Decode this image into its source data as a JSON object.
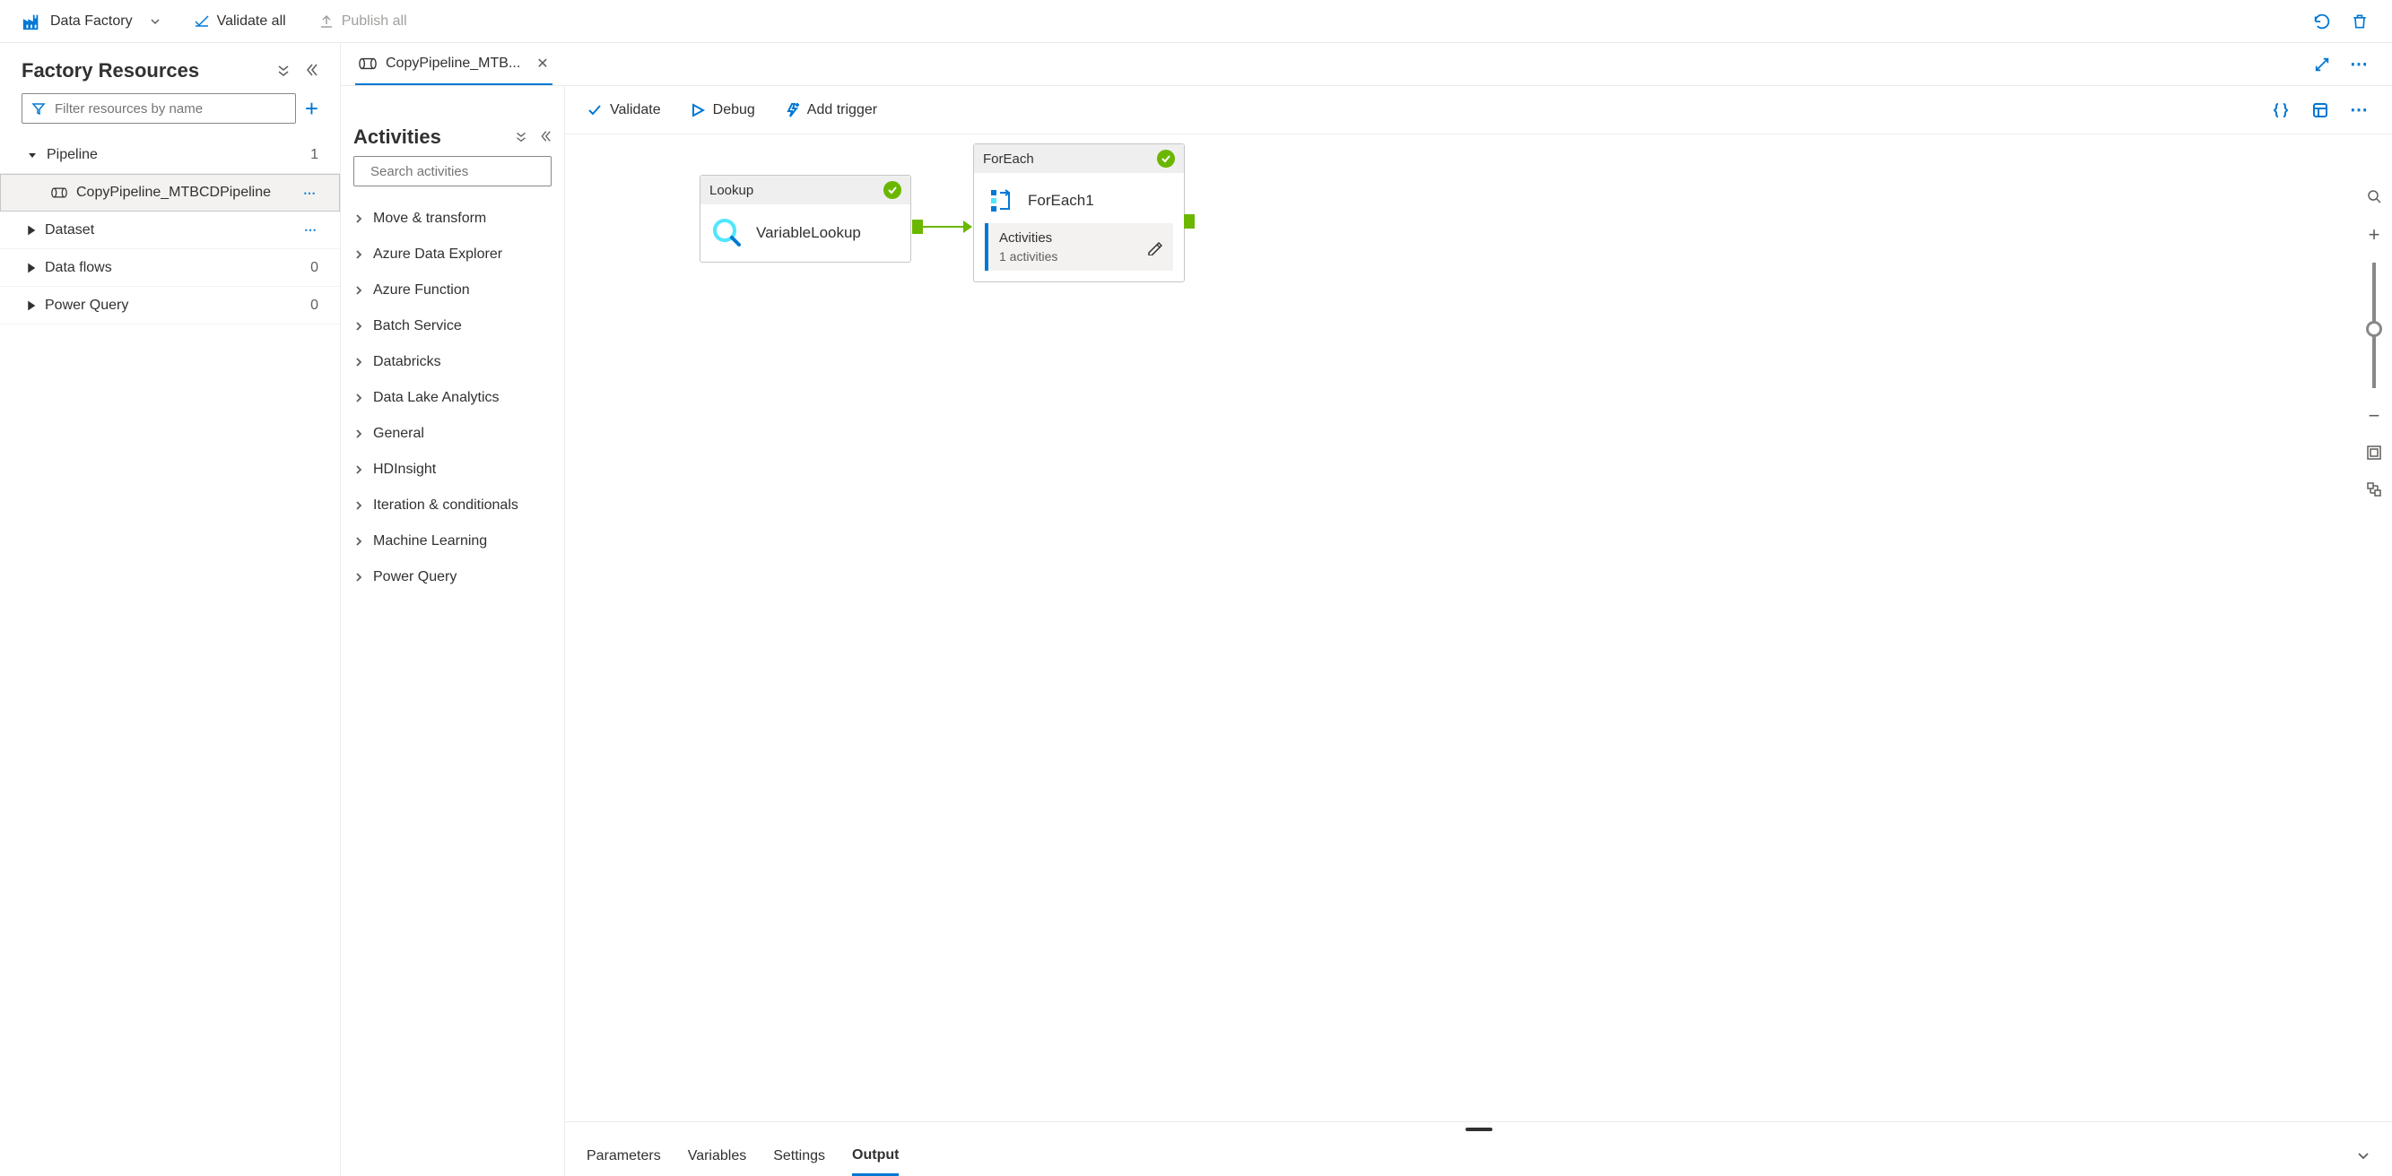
{
  "toolbar": {
    "brand": "Data Factory",
    "validate_all": "Validate all",
    "publish_all": "Publish all"
  },
  "left": {
    "title": "Factory Resources",
    "filter_placeholder": "Filter resources by name",
    "groups": [
      {
        "label": "Pipeline",
        "count": "1",
        "expanded": true
      },
      {
        "label": "Dataset",
        "count": "",
        "expanded": false
      },
      {
        "label": "Data flows",
        "count": "0",
        "expanded": false
      },
      {
        "label": "Power Query",
        "count": "0",
        "expanded": false
      }
    ],
    "pipeline_item": "CopyPipeline_MTBCDPipeline"
  },
  "activities": {
    "title": "Activities",
    "search_placeholder": "Search activities",
    "groups": [
      "Move & transform",
      "Azure Data Explorer",
      "Azure Function",
      "Batch Service",
      "Databricks",
      "Data Lake Analytics",
      "General",
      "HDInsight",
      "Iteration & conditionals",
      "Machine Learning",
      "Power Query"
    ]
  },
  "tab": {
    "label": "CopyPipeline_MTB..."
  },
  "canvas_toolbar": {
    "validate": "Validate",
    "debug": "Debug",
    "add_trigger": "Add trigger"
  },
  "nodes": {
    "lookup": {
      "type": "Lookup",
      "name": "VariableLookup"
    },
    "foreach": {
      "type": "ForEach",
      "name": "ForEach1",
      "activities_label": "Activities",
      "activities_count": "1 activities"
    }
  },
  "bottom_tabs": [
    "Parameters",
    "Variables",
    "Settings",
    "Output"
  ],
  "bottom_active": 3
}
